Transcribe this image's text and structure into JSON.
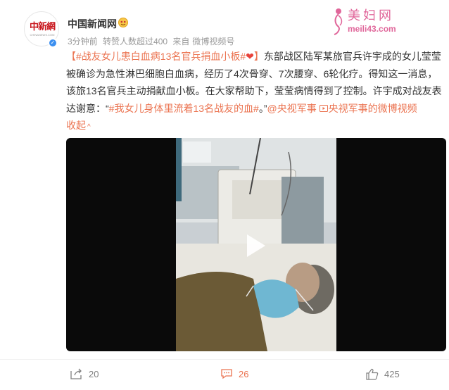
{
  "post": {
    "author": {
      "name": "中国新闻网",
      "avatar_text": "中新網",
      "avatar_sub": "CHINANEWS.COM"
    },
    "meta": {
      "time": "3分钟前",
      "reads": "转赞人数超过400",
      "source_prefix": "来自",
      "source": "微博视频号"
    },
    "text": {
      "hashtag_open": "【",
      "hashtag": "#战友女儿患白血病13名官兵捐血小板#",
      "heart": "❤",
      "hashtag_close": "】",
      "body1": "东部战区陆军某旅官兵许宇成的女儿莹莹被确诊为急性淋巴细胞白血病，经历了4次骨穿、7次腰穿、6轮化疗。得知这一消息，该旅13名官兵主动捐献血小板。在大家帮助下，莹莹病情得到了控制。许宇成对战友表达谢意：“",
      "quote_tag": "#我女儿身体里流着13名战友的血#",
      "body2": "。”",
      "mention": "@央视军事",
      "video_link": "央视军事的微博视频",
      "collapse": "收起",
      "collapse_icon": "^"
    },
    "actions": {
      "share": "20",
      "comment": "26",
      "like": "425"
    }
  },
  "watermark": {
    "title": "美妇网",
    "url": "meili43.com"
  },
  "colors": {
    "link": "#eb7350",
    "muted": "#999999",
    "verified": "#3b8ff0"
  },
  "icons": [
    "verified-icon",
    "badge-icon",
    "play-icon",
    "video-link-icon",
    "share-icon",
    "comment-icon",
    "like-icon"
  ]
}
